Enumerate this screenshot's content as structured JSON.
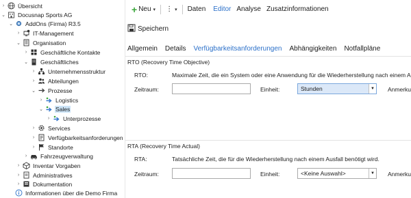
{
  "tree": {
    "items": [
      {
        "label": "Übersicht"
      },
      {
        "label": "Docusnap Sports AG"
      },
      {
        "label": "AddOns (Firma) R3.5"
      },
      {
        "label": "IT-Management"
      },
      {
        "label": "Organisation"
      },
      {
        "label": "Geschäftliche Kontakte"
      },
      {
        "label": "Geschäftliches"
      },
      {
        "label": "Unternehmensstruktur"
      },
      {
        "label": "Abteilungen"
      },
      {
        "label": "Prozesse"
      },
      {
        "label": "Logistics"
      },
      {
        "label": "Sales"
      },
      {
        "label": "Unterprozesse"
      },
      {
        "label": "Services"
      },
      {
        "label": "Verfügbarkeitsanforderungen"
      },
      {
        "label": "Standorte"
      },
      {
        "label": "Fahrzeugverwaltung"
      },
      {
        "label": "Inventar Vorgaben"
      },
      {
        "label": "Administratives"
      },
      {
        "label": "Dokumentation"
      },
      {
        "label": "Informationen über die Demo Firma"
      }
    ]
  },
  "toolbar": {
    "new_label": "Neu",
    "more_label": "⋮",
    "menu": [
      "Daten",
      "Editor",
      "Analyse",
      "Zusatzinformationen"
    ],
    "active": "Editor",
    "save_label": "Speichern"
  },
  "tabs": {
    "items": [
      "Allgemein",
      "Details",
      "Verfügbarkeitsanforderungen",
      "Abhängigkeiten",
      "Notfallpläne"
    ],
    "active": "Verfügbarkeitsanforderungen"
  },
  "rto": {
    "title": "RTO (Recovery Time Objective)",
    "key_label": "RTO:",
    "description": "Maximale Zeit, die ein System oder eine Anwendung für die Wiederherstellung nach einem Au",
    "zeitraum_label": "Zeitraum:",
    "zeitraum_value": "",
    "einheit_label": "Einheit:",
    "einheit_value": "Stunden",
    "anmerkung_label": "Anmerkur"
  },
  "rta": {
    "title": "RTA (Recovery Time Actual)",
    "key_label": "RTA:",
    "description": "Tatsächliche Zeit, die für die Wiederherstellung nach einem Ausfall benötigt wird.",
    "zeitraum_label": "Zeitraum:",
    "zeitraum_value": "",
    "einheit_label": "Einheit:",
    "einheit_value": "<Keine Auswahl>",
    "anmerkung_label": "Anmerkur"
  },
  "colors": {
    "accent": "#2b70c9",
    "selection": "#cce4f7",
    "combo_filled": "#dbe8f8",
    "plus_green": "#3aa63a"
  }
}
